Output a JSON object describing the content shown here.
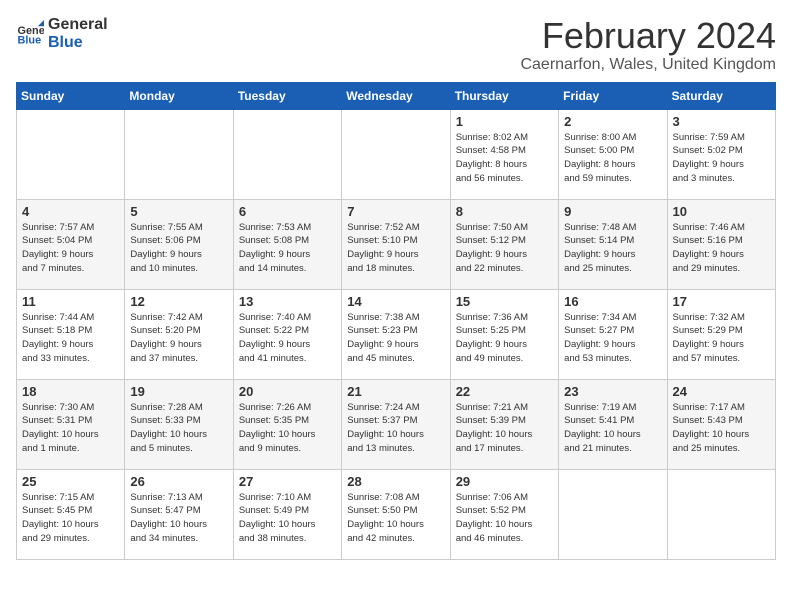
{
  "header": {
    "logo_line1": "General",
    "logo_line2": "Blue",
    "title": "February 2024",
    "subtitle": "Caernarfon, Wales, United Kingdom"
  },
  "weekdays": [
    "Sunday",
    "Monday",
    "Tuesday",
    "Wednesday",
    "Thursday",
    "Friday",
    "Saturday"
  ],
  "weeks": [
    [
      {
        "day": "",
        "info": ""
      },
      {
        "day": "",
        "info": ""
      },
      {
        "day": "",
        "info": ""
      },
      {
        "day": "",
        "info": ""
      },
      {
        "day": "1",
        "info": "Sunrise: 8:02 AM\nSunset: 4:58 PM\nDaylight: 8 hours\nand 56 minutes."
      },
      {
        "day": "2",
        "info": "Sunrise: 8:00 AM\nSunset: 5:00 PM\nDaylight: 8 hours\nand 59 minutes."
      },
      {
        "day": "3",
        "info": "Sunrise: 7:59 AM\nSunset: 5:02 PM\nDaylight: 9 hours\nand 3 minutes."
      }
    ],
    [
      {
        "day": "4",
        "info": "Sunrise: 7:57 AM\nSunset: 5:04 PM\nDaylight: 9 hours\nand 7 minutes."
      },
      {
        "day": "5",
        "info": "Sunrise: 7:55 AM\nSunset: 5:06 PM\nDaylight: 9 hours\nand 10 minutes."
      },
      {
        "day": "6",
        "info": "Sunrise: 7:53 AM\nSunset: 5:08 PM\nDaylight: 9 hours\nand 14 minutes."
      },
      {
        "day": "7",
        "info": "Sunrise: 7:52 AM\nSunset: 5:10 PM\nDaylight: 9 hours\nand 18 minutes."
      },
      {
        "day": "8",
        "info": "Sunrise: 7:50 AM\nSunset: 5:12 PM\nDaylight: 9 hours\nand 22 minutes."
      },
      {
        "day": "9",
        "info": "Sunrise: 7:48 AM\nSunset: 5:14 PM\nDaylight: 9 hours\nand 25 minutes."
      },
      {
        "day": "10",
        "info": "Sunrise: 7:46 AM\nSunset: 5:16 PM\nDaylight: 9 hours\nand 29 minutes."
      }
    ],
    [
      {
        "day": "11",
        "info": "Sunrise: 7:44 AM\nSunset: 5:18 PM\nDaylight: 9 hours\nand 33 minutes."
      },
      {
        "day": "12",
        "info": "Sunrise: 7:42 AM\nSunset: 5:20 PM\nDaylight: 9 hours\nand 37 minutes."
      },
      {
        "day": "13",
        "info": "Sunrise: 7:40 AM\nSunset: 5:22 PM\nDaylight: 9 hours\nand 41 minutes."
      },
      {
        "day": "14",
        "info": "Sunrise: 7:38 AM\nSunset: 5:23 PM\nDaylight: 9 hours\nand 45 minutes."
      },
      {
        "day": "15",
        "info": "Sunrise: 7:36 AM\nSunset: 5:25 PM\nDaylight: 9 hours\nand 49 minutes."
      },
      {
        "day": "16",
        "info": "Sunrise: 7:34 AM\nSunset: 5:27 PM\nDaylight: 9 hours\nand 53 minutes."
      },
      {
        "day": "17",
        "info": "Sunrise: 7:32 AM\nSunset: 5:29 PM\nDaylight: 9 hours\nand 57 minutes."
      }
    ],
    [
      {
        "day": "18",
        "info": "Sunrise: 7:30 AM\nSunset: 5:31 PM\nDaylight: 10 hours\nand 1 minute."
      },
      {
        "day": "19",
        "info": "Sunrise: 7:28 AM\nSunset: 5:33 PM\nDaylight: 10 hours\nand 5 minutes."
      },
      {
        "day": "20",
        "info": "Sunrise: 7:26 AM\nSunset: 5:35 PM\nDaylight: 10 hours\nand 9 minutes."
      },
      {
        "day": "21",
        "info": "Sunrise: 7:24 AM\nSunset: 5:37 PM\nDaylight: 10 hours\nand 13 minutes."
      },
      {
        "day": "22",
        "info": "Sunrise: 7:21 AM\nSunset: 5:39 PM\nDaylight: 10 hours\nand 17 minutes."
      },
      {
        "day": "23",
        "info": "Sunrise: 7:19 AM\nSunset: 5:41 PM\nDaylight: 10 hours\nand 21 minutes."
      },
      {
        "day": "24",
        "info": "Sunrise: 7:17 AM\nSunset: 5:43 PM\nDaylight: 10 hours\nand 25 minutes."
      }
    ],
    [
      {
        "day": "25",
        "info": "Sunrise: 7:15 AM\nSunset: 5:45 PM\nDaylight: 10 hours\nand 29 minutes."
      },
      {
        "day": "26",
        "info": "Sunrise: 7:13 AM\nSunset: 5:47 PM\nDaylight: 10 hours\nand 34 minutes."
      },
      {
        "day": "27",
        "info": "Sunrise: 7:10 AM\nSunset: 5:49 PM\nDaylight: 10 hours\nand 38 minutes."
      },
      {
        "day": "28",
        "info": "Sunrise: 7:08 AM\nSunset: 5:50 PM\nDaylight: 10 hours\nand 42 minutes."
      },
      {
        "day": "29",
        "info": "Sunrise: 7:06 AM\nSunset: 5:52 PM\nDaylight: 10 hours\nand 46 minutes."
      },
      {
        "day": "",
        "info": ""
      },
      {
        "day": "",
        "info": ""
      }
    ]
  ]
}
